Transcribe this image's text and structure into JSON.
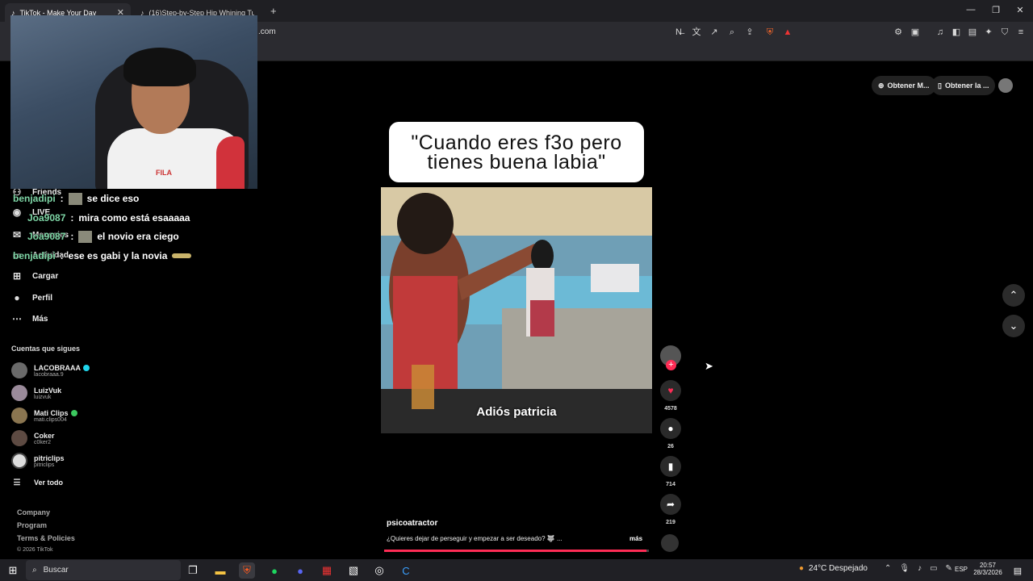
{
  "browser": {
    "tabs": [
      {
        "title": "TikTok - Make Your Day",
        "active": true
      },
      {
        "title": "(16)Step-by-Step Hip Whining Tutor...",
        "active": false
      }
    ],
    "new_tab": "+",
    "address_fragment": ".com",
    "window_controls": [
      "—",
      "❐",
      "✕"
    ],
    "close_glyph": "✕"
  },
  "header": {
    "obtain_app": "Obtener M...",
    "obtain_desktop": "Obtener la ..."
  },
  "sidebar": {
    "nav_items": [
      {
        "label": "Friends",
        "icon": "friends-icon"
      },
      {
        "label": "LIVE",
        "icon": "live-icon"
      },
      {
        "label": "Mensajes",
        "icon": "messages-icon"
      },
      {
        "label": "Actividad",
        "icon": "activity-icon"
      },
      {
        "label": "Cargar",
        "icon": "upload-icon"
      },
      {
        "label": "Perfil",
        "icon": "profile-icon"
      },
      {
        "label": "Más",
        "icon": "more-icon"
      }
    ],
    "following_title": "Cuentas que sigues",
    "following": [
      {
        "name": "LACOBRAAA",
        "handle": "lacobraaa.9",
        "badge": "verified",
        "badge_color": "#20d5ec"
      },
      {
        "name": "LuizVuk",
        "handle": "luizvuk",
        "badge": "",
        "badge_color": ""
      },
      {
        "name": "Mati Clips",
        "handle": "mati.clips004",
        "badge": "live",
        "badge_color": "#3cc95f"
      },
      {
        "name": "Coker",
        "handle": "c0ker2",
        "badge": "",
        "badge_color": ""
      },
      {
        "name": "pitriclips",
        "handle": "pitriclips",
        "badge": "",
        "badge_color": ""
      }
    ],
    "see_all": "Ver todo",
    "footer": [
      "Company",
      "Program",
      "Terms & Policies",
      "© 2026 TikTok"
    ]
  },
  "chat": [
    {
      "user": "benjadipi",
      "message": "se dice eso",
      "emote": true
    },
    {
      "user": "Joa9087",
      "message": "mira como está esaaaaa",
      "emote": false
    },
    {
      "user": "Joa9087",
      "message": "el novio era ciego",
      "emote": true
    },
    {
      "user": "benjadipi",
      "message": "ese es gabi y la novia",
      "emote": false
    }
  ],
  "video": {
    "caption_line1": "\"Cuando eres f3o pero",
    "caption_line2": "tienes buena labia\"",
    "subtitle": "Adiós patricia",
    "author": "psicoatractor",
    "description": "¿Quieres dejar de perseguir y empezar a ser deseado? 🐺 ...",
    "more": "más",
    "progress": 0.99
  },
  "actions": {
    "likes": "4578",
    "comments": "26",
    "saves": "714",
    "shares": "219"
  },
  "taskbar": {
    "search_placeholder": "Buscar",
    "weather": "24°C  Despejado",
    "lang": "ESP",
    "time": "20:57",
    "date": "28/3/2026"
  },
  "colors": {
    "accent": "#fe2c55",
    "chat_user": "#7ed6a6"
  }
}
